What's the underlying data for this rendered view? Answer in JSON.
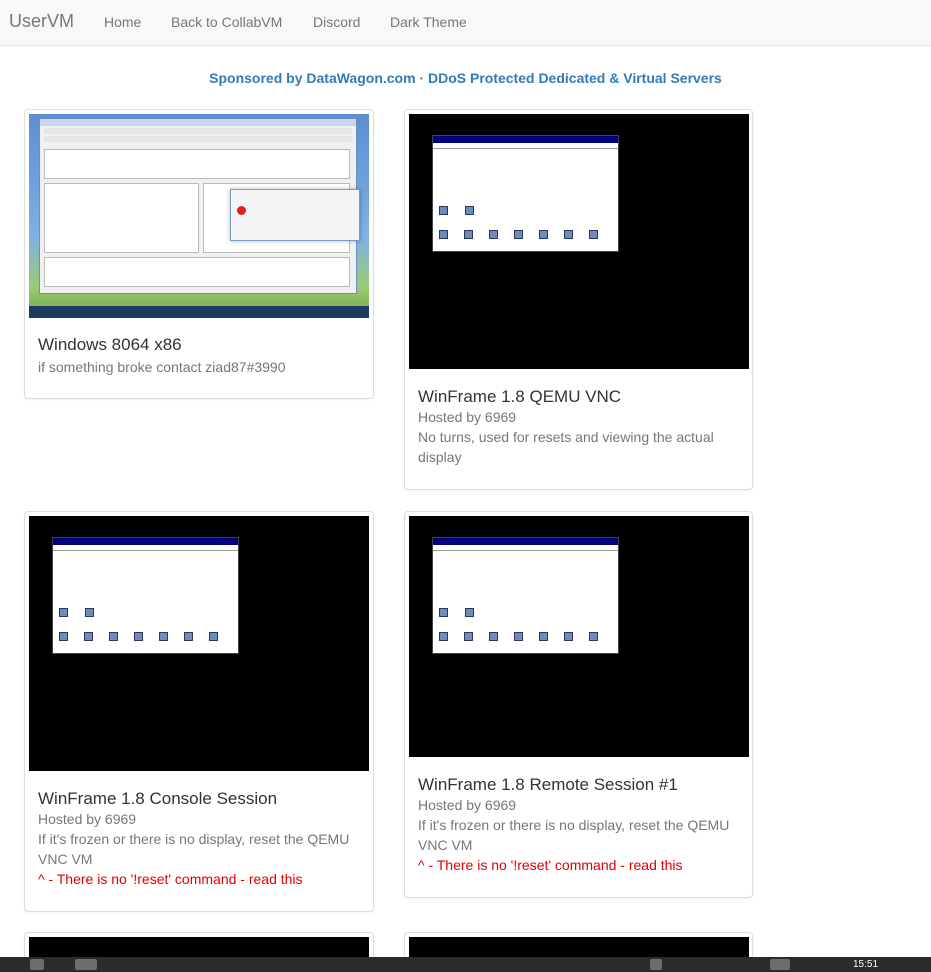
{
  "navbar": {
    "brand": "UserVM",
    "links": [
      "Home",
      "Back to CollabVM",
      "Discord",
      "Dark Theme"
    ]
  },
  "sponsor": "Sponsored by DataWagon.com · DDoS Protected Dedicated & Virtual Servers",
  "vms": [
    {
      "title": "Windows 8064 x86",
      "lines": [
        "if something broke contact ziad87#3990"
      ],
      "warning": ""
    },
    {
      "title": "WinFrame 1.8 QEMU VNC",
      "lines": [
        "Hosted by 6969",
        "No turns, used for resets and viewing the actual display"
      ],
      "warning": ""
    },
    {
      "title": "WinFrame 1.8 Console Session",
      "lines": [
        "Hosted by 6969",
        "If it's frozen or there is no display, reset the QEMU VNC VM"
      ],
      "warning": "^ - There is no '!reset' command - read this"
    },
    {
      "title": "WinFrame 1.8 Remote Session #1",
      "lines": [
        "Hosted by 6969",
        "If it's frozen or there is no display, reset the QEMU VNC VM"
      ],
      "warning": "^ - There is no '!reset' command - read this"
    }
  ],
  "taskbar": {
    "clock": "15:51"
  },
  "colors": {
    "link": "#337ab7",
    "warning": "#e00000",
    "navbar": "#f8f8f8"
  }
}
